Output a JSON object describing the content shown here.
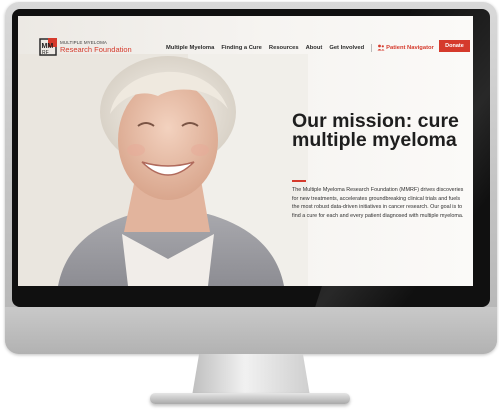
{
  "site": {
    "logo": {
      "mark_text": "MM",
      "mark_sub": "RF",
      "line1": "MULTIPLE MYELOMA",
      "line2": "Research Foundation"
    },
    "nav": {
      "links": [
        "Multiple Myeloma",
        "Finding a Cure",
        "Resources",
        "About",
        "Get Involved"
      ],
      "patient_navigator": "Patient Navigator",
      "donate": "Donate"
    },
    "hero": {
      "title": "Our mission: cure multiple myeloma",
      "description": "The Multiple Myeloma Research Foundation (MMRF) drives discoveries for new treatments, accelerates groundbreaking clinical trials and fuels the most robust data-driven initiatives in cancer research. Our goal is to find a cure for each and every patient diagnosed with multiple myeloma."
    }
  },
  "colors": {
    "brand_red": "#d53a2c",
    "title_text": "#1e1e1e",
    "monitor_bezel": "#101010",
    "monitor_body": "#c3c3c3"
  },
  "icons": [
    "logo-mark-icon",
    "patient-navigator-icon",
    "search-icon"
  ]
}
